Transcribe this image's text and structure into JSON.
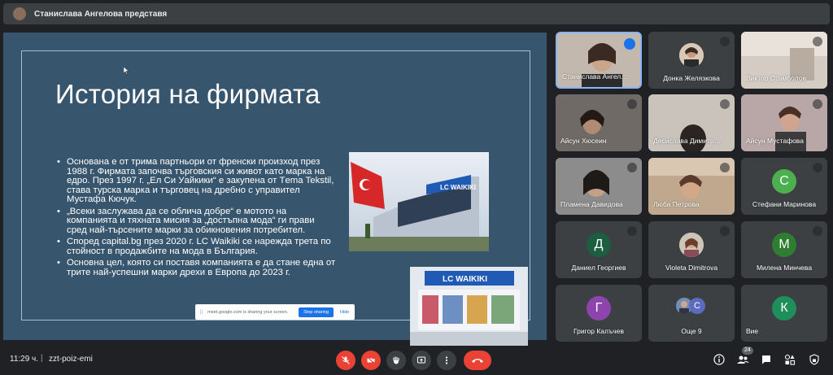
{
  "presenter_bar": {
    "text": "Станислава Ангелова представя"
  },
  "slide": {
    "title": "История на фирмата",
    "bullets": [
      "Основана е от трима партньори от френски произход през 1988 г. Фирмата започва търговския си живот като марка на едро. През 1997 г. „Ел Си Уайкики“ е закупена от Тema Tekstil, става турска марка и търговец на дребно с управител Мустафа Кючук.",
      "„Всеки заслужава да се облича добре“ е мотото на компанията и тяхната мисия за „достъпна мода“ ги прави сред най-търсените марки за обикновения потребител.",
      "Според capital.bg през 2020 г. LC Waikiki  се нарежда трета по стойност в продажбите на мода в България.",
      "Основна цел, която си поставя компанията е да стане една от трите най-успешни марки дрехи в Европа до 2023 г."
    ],
    "image1_sign": "LC WAIKIKI",
    "image2_sign": "LC WAIKIKI"
  },
  "share_banner": {
    "handle": "||",
    "message": "meet.google.com is sharing your screen.",
    "stop_label": "Stop sharing",
    "hide_label": "Hide"
  },
  "participants": [
    {
      "name": "Станислава Ангел…",
      "type": "video"
    },
    {
      "name": "Донка Желязкова",
      "type": "photo"
    },
    {
      "name": "Виктор Стамболов",
      "type": "video"
    },
    {
      "name": "Айсун Хюсеин",
      "type": "video"
    },
    {
      "name": "Десислава Димитр…",
      "type": "video"
    },
    {
      "name": "Айсун Мустафова",
      "type": "video"
    },
    {
      "name": "Пламена Давидова",
      "type": "video"
    },
    {
      "name": "Люба Петрова",
      "type": "video"
    },
    {
      "name": "Стефани Маринова",
      "type": "letter",
      "letter": "С",
      "color": "#4caf50"
    },
    {
      "name": "Даниел Георгиев",
      "type": "letter",
      "letter": "Д",
      "color": "#1b5e40"
    },
    {
      "name": "Violeta Dimitrova",
      "type": "photo"
    },
    {
      "name": "Милена Минчева",
      "type": "letter",
      "letter": "М",
      "color": "#2e7d32"
    },
    {
      "name": "Григор Калъчев",
      "type": "letter",
      "letter": "Г",
      "color": "#8e44ad"
    },
    {
      "name": "Още 9",
      "type": "more",
      "letter": "С",
      "color": "#5c6bc0"
    },
    {
      "name": "Вие",
      "type": "letter",
      "letter": "К",
      "color": "#1e8e5a"
    }
  ],
  "bottom_bar": {
    "time": "11:29 ч.",
    "separator": "|",
    "meeting_code": "zzt-poiz-emi",
    "people_count": "24"
  },
  "colors": {
    "slide_bg": "#37566e",
    "control_red": "#ea4335",
    "control_gray": "#3c4043",
    "speaking_blue": "#1a73e8"
  }
}
